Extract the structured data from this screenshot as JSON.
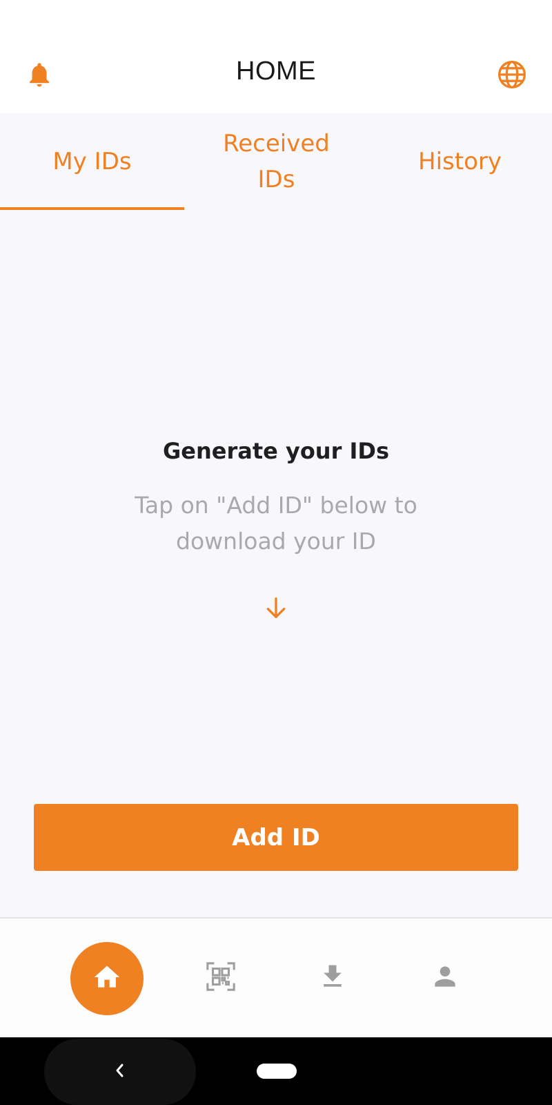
{
  "app_bar": {
    "title": "HOME",
    "left_icon": "bell-icon",
    "right_icon": "globe-icon"
  },
  "tabs": [
    {
      "label": "My IDs",
      "active": true
    },
    {
      "label": "Received IDs",
      "active": false
    },
    {
      "label": "History",
      "active": false
    }
  ],
  "empty_state": {
    "title": "Generate your IDs",
    "subtitle": "Tap on \"Add ID\" below to download your ID",
    "icon": "arrow-down-icon"
  },
  "add_button": {
    "label": "Add ID"
  },
  "bottom_nav": {
    "items": [
      {
        "icon": "home-icon",
        "active": true
      },
      {
        "icon": "qr-code-icon",
        "active": false
      },
      {
        "icon": "download-icon",
        "active": false
      },
      {
        "icon": "profile-icon",
        "active": false
      }
    ]
  },
  "colors": {
    "accent": "#f08122",
    "background": "#f8f7fc",
    "inactive_icon": "#9e9e9e",
    "subtitle_text": "#a9a9a9"
  }
}
